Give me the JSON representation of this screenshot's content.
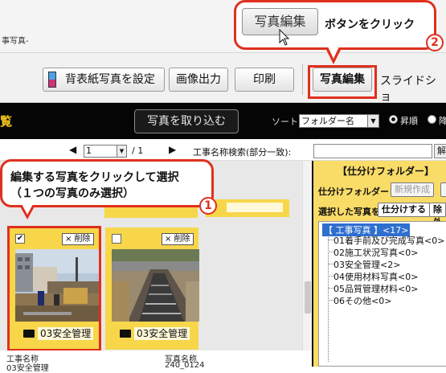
{
  "window": {
    "title_fragment": "事写真-"
  },
  "toolbar": {
    "set_spine_photo": "背表紙写真を設定",
    "image_output": "画像出力",
    "print": "印刷",
    "photo_edit": "写真編集",
    "slideshow": "スライドショ"
  },
  "darkbar": {
    "left_char": "覧",
    "import_photos": "写真を取り込む",
    "sort_label": "ソート",
    "sort_value": "フォルダー名",
    "ascending": "昇順",
    "descending": "降"
  },
  "nav": {
    "prev": "◀",
    "page": "1",
    "page_total": "/ 1",
    "next": "▶",
    "search_label": "工事名称検索(部分一致):",
    "search_value": "",
    "search_button": "解"
  },
  "cards": [
    {
      "checked": true,
      "check_mark": "✔",
      "delete": "× 削除",
      "folder": "03安全管理"
    },
    {
      "checked": false,
      "check_mark": "",
      "delete": "× 削除",
      "folder": "03安全管理"
    }
  ],
  "info": {
    "left_label": "工事名称",
    "left_value": "03安全管理",
    "right_label": "写真名称",
    "right_value": "240_0124"
  },
  "right_panel": {
    "header": "【仕分けフォルダー】",
    "folder_label": "仕分けフォルダー",
    "new_button": "新規作成",
    "selected_label": "選択した写真を",
    "sort_button": "仕分けする",
    "exclude_button": "除外",
    "tree": [
      "【 工事写真 】<17>",
      "01着手前及び完成写真<0>",
      "02施工状況写真<0>",
      "03安全管理<2>",
      "04使用材料写真<0>",
      "05品質管理材料<0>",
      "06その他<0>"
    ]
  },
  "callout1": {
    "line1": "編集する写真をクリックして選択",
    "line2": "（１つの写真のみ選択）",
    "number": "1"
  },
  "callout2": {
    "button": "写真編集",
    "text": "ボタンをクリック",
    "number": "2"
  }
}
